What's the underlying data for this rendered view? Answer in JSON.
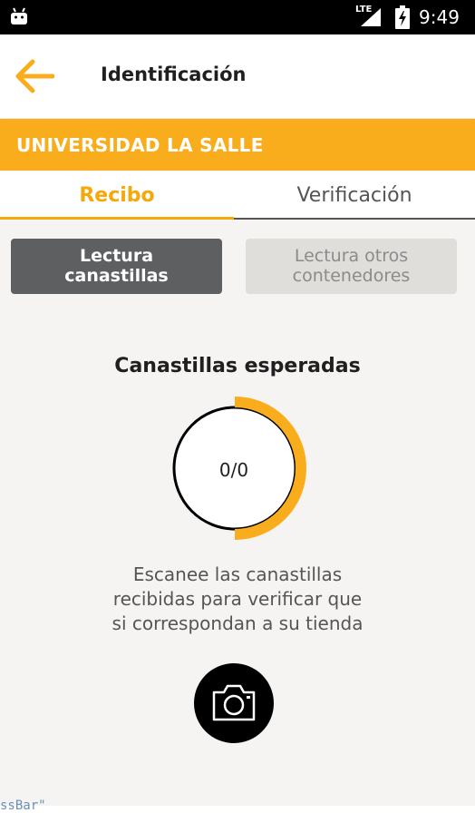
{
  "status_bar": {
    "network": "LTE",
    "time": "9:49",
    "icons": [
      "android-icon",
      "signal-icon",
      "battery-charging-icon"
    ]
  },
  "app_bar": {
    "title": "Identificación",
    "back_icon": "arrow-left-icon",
    "accent_color": "#f9ad1c"
  },
  "banner": {
    "text": "UNIVERSIDAD LA SALLE"
  },
  "tabs": [
    {
      "label": "Recibo",
      "active": true
    },
    {
      "label": "Verificación",
      "active": false
    }
  ],
  "reading_mode": {
    "options": [
      {
        "line1": "Lectura",
        "line2": "canastillas",
        "active": true
      },
      {
        "line1": "Lectura otros",
        "line2": "contenedores",
        "active": false
      }
    ]
  },
  "counter": {
    "title": "Canastillas esperadas",
    "value": "0/0",
    "ring_progress_fraction": 0.5,
    "ring_color": "#f9ad1c"
  },
  "instructions": {
    "line1": "Escanee las canastillas",
    "line2": "recibidas para verificar que",
    "line3": "si correspondan a su tienda"
  },
  "camera_button": {
    "icon": "camera-icon"
  },
  "bottom_fragment": "ssBar\""
}
